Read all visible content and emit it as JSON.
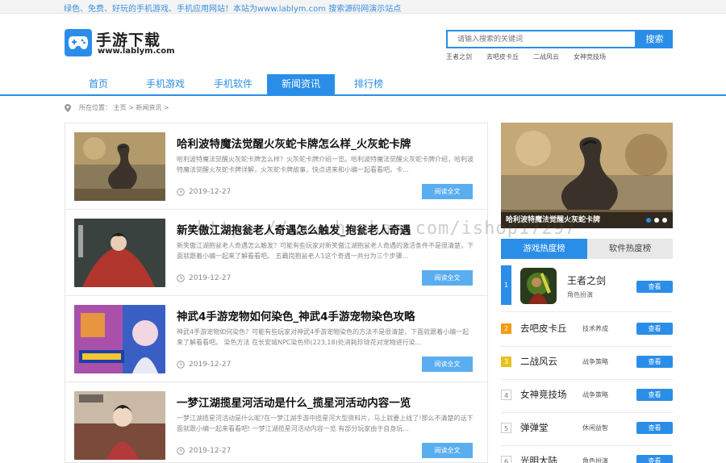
{
  "topbar": {
    "text": "绿色、免费、好玩的手机游戏、手机应用网站！本站为www.lablym.com 搜索源码网演示站点"
  },
  "header": {
    "logo_title": "手游下载",
    "logo_url": "www.lablym.com",
    "search_placeholder": "请输入搜索的关键词",
    "search_button": "搜索",
    "hot_words": [
      "王者之剑",
      "去吧皮卡丘",
      "二战风云",
      "女神竞技场"
    ]
  },
  "nav": {
    "items": [
      {
        "label": "首页"
      },
      {
        "label": "手机游戏"
      },
      {
        "label": "手机软件"
      },
      {
        "label": "新闻资讯"
      },
      {
        "label": "排行榜"
      }
    ],
    "active_index": 3
  },
  "breadcrumb": {
    "text": "所在位置： 主页 > 新闻资讯 >"
  },
  "articles": [
    {
      "title": "哈利波特魔法觉醒火灰蛇卡牌怎么样_火灰蛇卡牌",
      "desc": "哈利波特魔法觉醒火灰蛇卡牌怎么样？火灰蛇卡牌介绍一览。哈利波特魔法觉醒火灰蛇卡牌介绍，哈利波特魔法觉醒火灰蛇卡牌详解，火灰蛇卡牌故事，快点进来和小编一起看看吧。卡...",
      "date": "2019-12-27",
      "button": "阅读全文"
    },
    {
      "title": "新笑傲江湖抱瓮老人奇遇怎么触发_抱瓮老人奇遇",
      "desc": "新笑傲江湖抱瓮老人奇遇怎么触发？可能有些玩家对新笑傲江湖抱瓮老人奇遇的激活条件不是很清楚，下面就跟着小编一起来了解看看吧。 五霸岗抱瓮老人1这个奇遇一共分为三个步骤...",
      "date": "2019-12-27",
      "button": "阅读全文"
    },
    {
      "title": "神武4手游宠物如何染色_神武4手游宠物染色攻略",
      "desc": "神武4手游宠物如何染色？可能有些玩家对神武4手游宠物染色的方法不是很清楚，下面就跟着小编一起来了解看看吧。 染色方法 在长安城NPC染色师(223,18)处消耗珍珑花对宠物进行染...",
      "date": "2019-12-27",
      "button": "阅读全文"
    },
    {
      "title": "一梦江湖揽星河活动是什么_揽星河活动内容一览",
      "desc": "一梦江湖揽星河活动是什么呢?在一梦江湖手游中揽星河大型资料片，马上就要上线了!那么不清楚的话下面就跟小编一起来看看吧! 一梦江湖揽星河活动内容一览 有部分玩家由于自身玩...",
      "date": "2019-12-27",
      "button": "阅读全文"
    }
  ],
  "banner": {
    "caption": "哈利波特魔法觉醒火灰蛇卡牌"
  },
  "rank_tabs": {
    "active": "游戏热度榜",
    "inactive": "软件热度榜"
  },
  "ranking": [
    {
      "num": "1",
      "name": "王者之剑",
      "category": "角色扮演",
      "button": "查看"
    },
    {
      "num": "2",
      "name": "去吧皮卡丘",
      "category": "技术养成",
      "button": "查看"
    },
    {
      "num": "3",
      "name": "二战风云",
      "category": "战争策略",
      "button": "查看"
    },
    {
      "num": "4",
      "name": "女神竞技场",
      "category": "战争策略",
      "button": "查看"
    },
    {
      "num": "5",
      "name": "弹弹堂",
      "category": "休闲益智",
      "button": "查看"
    },
    {
      "num": "6",
      "name": "光明大陆",
      "category": "角色扮演",
      "button": "查看"
    }
  ],
  "colors": {
    "accent": "#2a8ee8",
    "rank2": "#f39c12",
    "rank3": "#e8c21c"
  },
  "watermark": "https://www.huzhan.com/ishop17297"
}
